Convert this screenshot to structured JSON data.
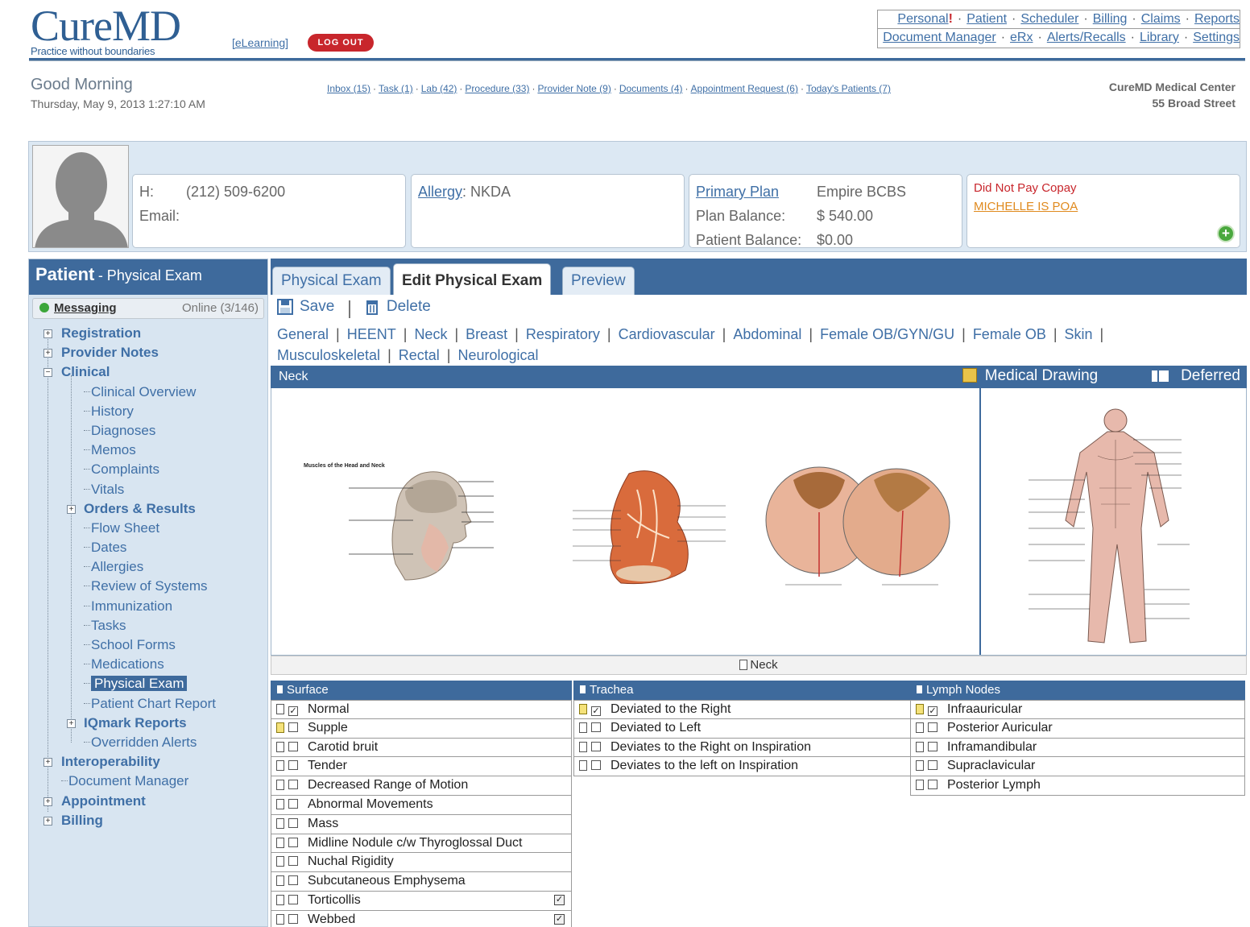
{
  "header": {
    "brand": "CureMD",
    "tagline": "Practice without boundaries",
    "elearning": "[eLearning]",
    "logout": "LOG OUT",
    "nav_row1": [
      "Personal",
      "Patient",
      "Scheduler",
      "Billing",
      "Claims",
      "Reports"
    ],
    "nav_row2": [
      "Document Manager",
      "eRx",
      "Alerts/Recalls",
      "Library",
      "Settings"
    ],
    "personal_alert": "!"
  },
  "greeting": {
    "title": "Good Morning",
    "datetime": "Thursday, May 9, 2013 1:27:10 AM"
  },
  "quick_links": [
    "Inbox (15)",
    "Task (1)",
    "Lab (42)",
    "Procedure (33)",
    "Provider Note (9)",
    "Documents (4)",
    "Appointment Request (6)",
    "Today's Patients (7)"
  ],
  "facility": {
    "name": "CureMD Medical Center",
    "address": "55 Broad Street"
  },
  "patient": {
    "phone_label": "H:",
    "phone": "(212) 509-6200",
    "email_label": "Email:",
    "allergy_label": "Allergy",
    "allergy_value": ": NKDA",
    "plan_label": "Primary Plan",
    "plan_value": "Empire BCBS",
    "plan_balance_label": "Plan Balance:",
    "plan_balance": "$ 540.00",
    "patient_balance_label": "Patient Balance:",
    "patient_balance": "$0.00",
    "alert1": "Did Not Pay Copay",
    "alert2": "MICHELLE IS POA"
  },
  "sidebar": {
    "title": "Patient",
    "subtitle": "- Physical Exam",
    "messaging": "Messaging",
    "online": "Online (3/146)",
    "tree": [
      {
        "label": "Registration",
        "level": 0,
        "toggle": "+"
      },
      {
        "label": "Provider Notes",
        "level": 0,
        "toggle": "+"
      },
      {
        "label": "Clinical",
        "level": 0,
        "toggle": "-"
      },
      {
        "label": "Clinical Overview",
        "level": 1
      },
      {
        "label": "History",
        "level": 1
      },
      {
        "label": "Diagnoses",
        "level": 1
      },
      {
        "label": "Memos",
        "level": 1
      },
      {
        "label": "Complaints",
        "level": 1
      },
      {
        "label": "Vitals",
        "level": 1
      },
      {
        "label": "Orders & Results",
        "level": 1,
        "toggle": "+",
        "bold": true
      },
      {
        "label": "Flow Sheet",
        "level": 1
      },
      {
        "label": "Dates",
        "level": 1
      },
      {
        "label": "Allergies",
        "level": 1
      },
      {
        "label": "Review of Systems",
        "level": 1
      },
      {
        "label": "Immunization",
        "level": 1
      },
      {
        "label": "Tasks",
        "level": 1
      },
      {
        "label": "School Forms",
        "level": 1
      },
      {
        "label": "Medications",
        "level": 1
      },
      {
        "label": "Physical Exam",
        "level": 1,
        "selected": true
      },
      {
        "label": "Patient Chart Report",
        "level": 1
      },
      {
        "label": "IQmark Reports",
        "level": 1,
        "toggle": "+"
      },
      {
        "label": "Overridden Alerts",
        "level": 1
      },
      {
        "label": "Interoperability",
        "level": 0,
        "toggle": "+"
      },
      {
        "label": "Document Manager",
        "level": 0,
        "plain": true
      },
      {
        "label": "Appointment",
        "level": 0,
        "toggle": "+"
      },
      {
        "label": "Billing",
        "level": 0,
        "toggle": "+"
      }
    ]
  },
  "tabs": [
    {
      "label": "Physical Exam",
      "active": false
    },
    {
      "label": "Edit Physical Exam",
      "active": true
    },
    {
      "label": "Preview",
      "active": false
    }
  ],
  "toolbar": {
    "save": "Save",
    "delete": "Delete"
  },
  "sections_row1": [
    "General",
    "HEENT",
    "Neck",
    "Breast",
    "Respiratory",
    "Cardiovascular",
    "Abdominal",
    "Female OB/GYN/GU",
    "Female OB",
    "Skin"
  ],
  "sections_row2": [
    "Musculoskeletal",
    "Rectal",
    "Neurological"
  ],
  "exam": {
    "section_title": "Neck",
    "medical_drawing": "Medical Drawing",
    "deferred": "Deferred",
    "drawing_caption": "Neck",
    "diagram1_title": "Muscles of the Head and Neck"
  },
  "columns": [
    {
      "title": "Surface",
      "items": [
        {
          "label": "Normal",
          "checked": true,
          "note": false,
          "right": false
        },
        {
          "label": "Supple",
          "checked": false,
          "note": true,
          "right": false
        },
        {
          "label": "Carotid bruit",
          "checked": false,
          "note": false,
          "right": false
        },
        {
          "label": "Tender",
          "checked": false,
          "note": false,
          "right": false
        },
        {
          "label": "Decreased Range of Motion",
          "checked": false,
          "note": false,
          "right": false
        },
        {
          "label": "Abnormal Movements",
          "checked": false,
          "note": false,
          "right": false
        },
        {
          "label": "Mass",
          "checked": false,
          "note": false,
          "right": false
        },
        {
          "label": "Midline Nodule c/w Thyroglossal Duct",
          "checked": false,
          "note": false,
          "right": false
        },
        {
          "label": "Nuchal Rigidity",
          "checked": false,
          "note": false,
          "right": false
        },
        {
          "label": "Subcutaneous Emphysema",
          "checked": false,
          "note": false,
          "right": false
        },
        {
          "label": "Torticollis",
          "checked": false,
          "note": false,
          "right": true
        },
        {
          "label": "Webbed",
          "checked": false,
          "note": false,
          "right": true
        }
      ]
    },
    {
      "title": "Trachea",
      "items": [
        {
          "label": "Deviated to the Right",
          "checked": true,
          "note": true,
          "right": false
        },
        {
          "label": "Deviated to Left",
          "checked": false,
          "note": false,
          "right": false
        },
        {
          "label": "Deviates to the Right on Inspiration",
          "checked": false,
          "note": false,
          "right": false
        },
        {
          "label": "Deviates to the left on Inspiration",
          "checked": false,
          "note": false,
          "right": false
        }
      ]
    },
    {
      "title": "Lymph Nodes",
      "items": [
        {
          "label": "Infraauricular",
          "checked": true,
          "note": true,
          "right": false
        },
        {
          "label": "Posterior Auricular",
          "checked": false,
          "note": false,
          "right": false
        },
        {
          "label": "Inframandibular",
          "checked": false,
          "note": false,
          "right": false
        },
        {
          "label": "Supraclavicular",
          "checked": false,
          "note": false,
          "right": false
        },
        {
          "label": "Posterior Lymph",
          "checked": false,
          "note": false,
          "right": false
        }
      ]
    }
  ]
}
